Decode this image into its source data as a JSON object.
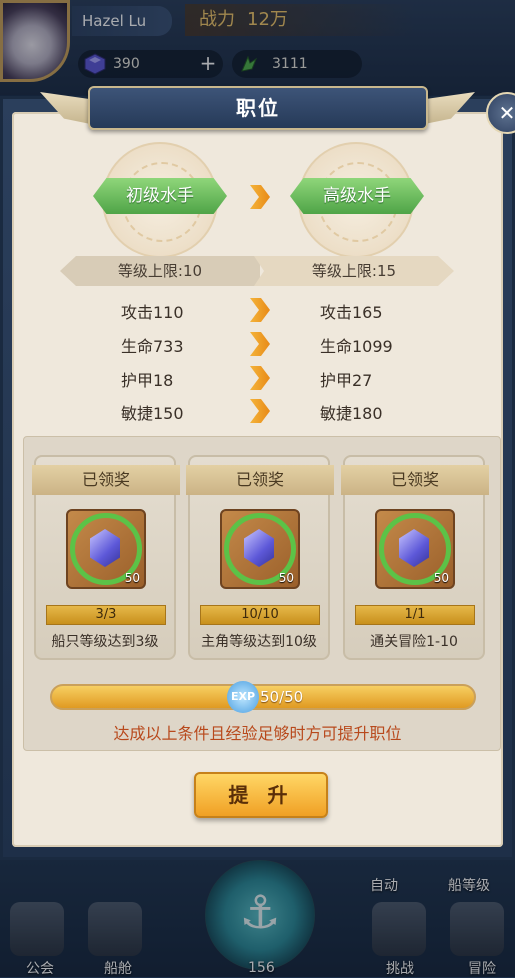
{
  "player": {
    "name": "Hazel Lu",
    "power_label": "战力",
    "power_value": "12万"
  },
  "resources": {
    "gems": "390",
    "gems_add": "+",
    "tokens": "3111"
  },
  "dialog": {
    "title": "职位",
    "close": "✕",
    "current_rank": "初级水手",
    "next_rank": "高级水手",
    "current_limit": "等级上限:10",
    "next_limit": "等级上限:15",
    "stats": [
      {
        "current": "攻击110",
        "next": "攻击165"
      },
      {
        "current": "生命733",
        "next": "生命1099"
      },
      {
        "current": "护甲18",
        "next": "护甲27"
      },
      {
        "current": "敏捷150",
        "next": "敏捷180"
      }
    ],
    "rewards": [
      {
        "status": "已领奖",
        "qty": "50",
        "progress": "3/3",
        "desc": "船只等级达到3级"
      },
      {
        "status": "已领奖",
        "qty": "50",
        "progress": "10/10",
        "desc": "主角等级达到10级"
      },
      {
        "status": "已领奖",
        "qty": "50",
        "progress": "1/1",
        "desc": "通关冒险1-10"
      }
    ],
    "exp_icon": "EXP",
    "exp": "50/50",
    "exp_fraction": 1.0,
    "notice": "达成以上条件且经验足够时方可提升职位",
    "promote_label": "提 升"
  },
  "bottom_nav": {
    "auto": "自动",
    "ship_level": "船等级",
    "guild": "公会",
    "cabin": "船舱",
    "challenge": "挑战",
    "adventure": "冒险",
    "counter": "156"
  },
  "colors": {
    "accent_green": "#5cc247",
    "rank_green": "#4fa447",
    "arrow_orange": "#e88a17",
    "notice_red": "#b8491c",
    "gold": "#f0a024"
  }
}
